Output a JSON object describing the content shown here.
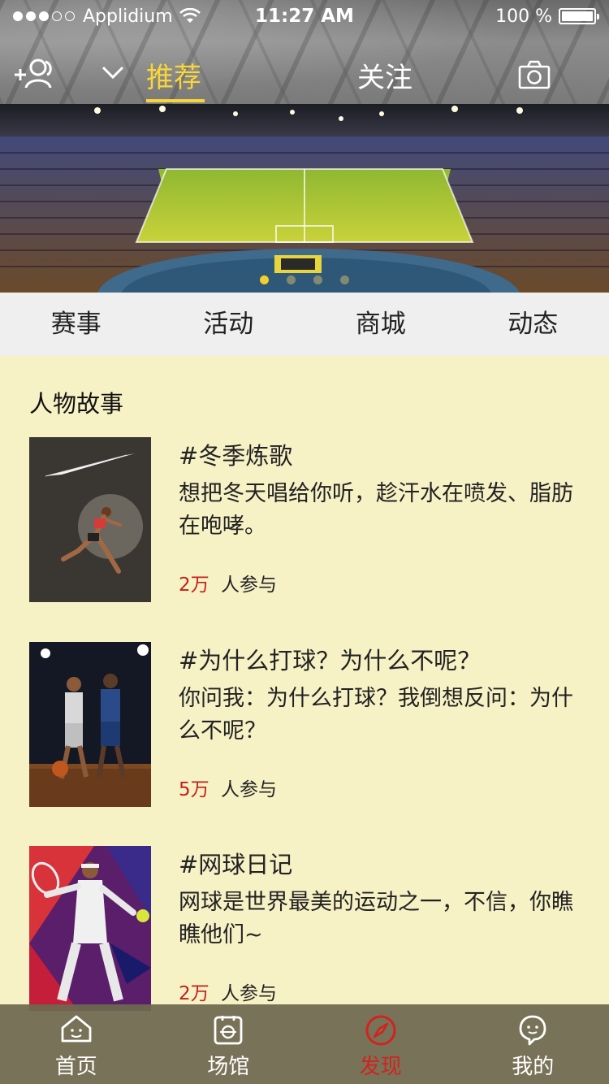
{
  "status": {
    "carrier": "Applidium",
    "time": "11:27 AM",
    "battery": "100 %",
    "signal_bars": 3,
    "signal_total": 5
  },
  "header": {
    "tabs": [
      {
        "label": "推荐",
        "active": true
      },
      {
        "label": "关注",
        "active": false
      }
    ],
    "icons": [
      "add-friend-icon",
      "chevron-down-icon",
      "camera-icon"
    ],
    "accent": "#f8d53a"
  },
  "banner": {
    "page_count": 4,
    "active_page": 0
  },
  "categories": [
    "赛事",
    "活动",
    "商城",
    "动态"
  ],
  "section": {
    "title": "人物故事"
  },
  "stories": [
    {
      "title": "#冬季炼歌",
      "desc": "想把冬天唱给你听，趁汗水在喷发、脂肪在咆哮。",
      "count": "2万",
      "count_label": "人参与"
    },
    {
      "title": "#为什么打球？为什么不呢？",
      "desc": "你问我：为什么打球？我倒想反问：为什么不呢？",
      "count": "5万",
      "count_label": "人参与"
    },
    {
      "title": "#网球日记",
      "desc": "网球是世界最美的运动之一，不信，你瞧瞧他们~",
      "count": "2万",
      "count_label": "人参与"
    }
  ],
  "tabbar": {
    "items": [
      {
        "label": "首页",
        "icon": "home-icon",
        "active": false
      },
      {
        "label": "场馆",
        "icon": "stadium-icon",
        "active": false
      },
      {
        "label": "发现",
        "icon": "compass-icon",
        "active": true
      },
      {
        "label": "我的",
        "icon": "profile-icon",
        "active": false
      }
    ],
    "active_color": "#d1231f"
  },
  "colors": {
    "page_bg": "#f7f1c6",
    "category_bg": "#efefef",
    "count_red": "#c41e1e"
  }
}
